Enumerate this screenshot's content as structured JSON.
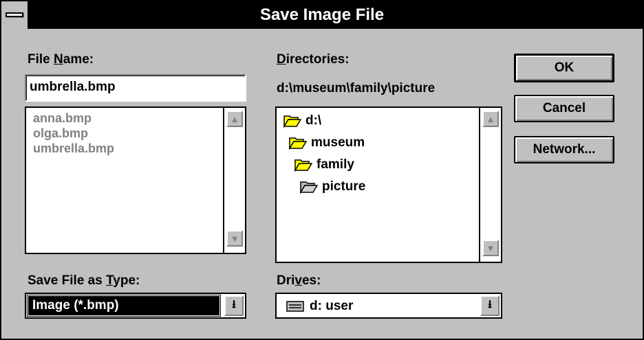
{
  "window": {
    "title": "Save Image File"
  },
  "file_name": {
    "label_pre": "File ",
    "label_u": "N",
    "label_post": "ame:",
    "value": "umbrella.bmp",
    "files": [
      "anna.bmp",
      "olga.bmp",
      "umbrella.bmp"
    ]
  },
  "directories": {
    "label_u": "D",
    "label_post": "irectories:",
    "current_path": "d:\\museum\\family\\picture",
    "tree": [
      "d:\\",
      "museum",
      "family",
      "picture"
    ]
  },
  "buttons": {
    "ok": "OK",
    "cancel": "Cancel",
    "network": "Network..."
  },
  "save_type": {
    "label_pre": "Save File as ",
    "label_u": "T",
    "label_post": "ype:",
    "value": "Image (*.bmp)"
  },
  "drives": {
    "label_pre": "Dri",
    "label_u": "v",
    "label_post": "es:",
    "value": "d: user"
  },
  "icons": {
    "system_menu": "system-menu-icon",
    "folder_open": "open-folder-icon",
    "drive": "drive-icon",
    "scroll_up": "scroll-up-arrow-icon",
    "scroll_down": "scroll-down-arrow-icon",
    "dropdown": "dropdown-arrow-icon"
  },
  "colors": {
    "face": "#c0c0c0",
    "title_bar": "#000000",
    "folder": "#ffff00",
    "disabled_text": "#808080"
  }
}
